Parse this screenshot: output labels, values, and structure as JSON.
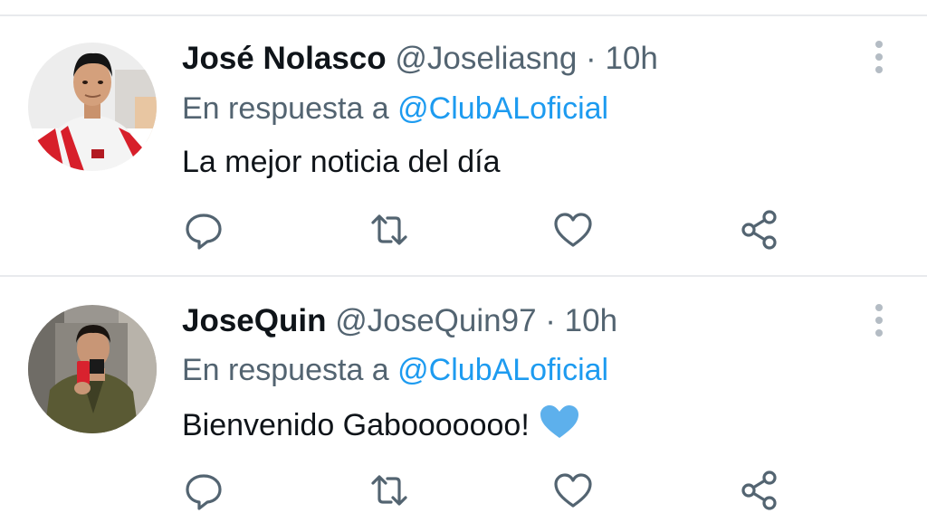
{
  "tweets": [
    {
      "display_name": "José Nolasco",
      "handle": "@Joseliasng",
      "separator": "·",
      "time": "10h",
      "reply_prefix": "En respuesta a",
      "reply_mention": "@ClubALoficial",
      "text": "La mejor noticia del día",
      "emoji": ""
    },
    {
      "display_name": "JoseQuin",
      "handle": "@JoseQuin97",
      "separator": "·",
      "time": "10h",
      "reply_prefix": "En respuesta a",
      "reply_mention": "@ClubALoficial",
      "text": "Bienvenido Gabooooooo!",
      "emoji": "blue-heart"
    }
  ],
  "icons": {
    "reply": "reply-icon",
    "retweet": "retweet-icon",
    "like": "like-icon",
    "share": "share-icon",
    "more": "more-options-icon"
  },
  "colors": {
    "text_primary": "#0f1419",
    "text_secondary": "#536471",
    "mention": "#1d9bf0",
    "divider": "#e8eaed",
    "icon": "#536471",
    "blue_heart": "#5db0ec"
  }
}
